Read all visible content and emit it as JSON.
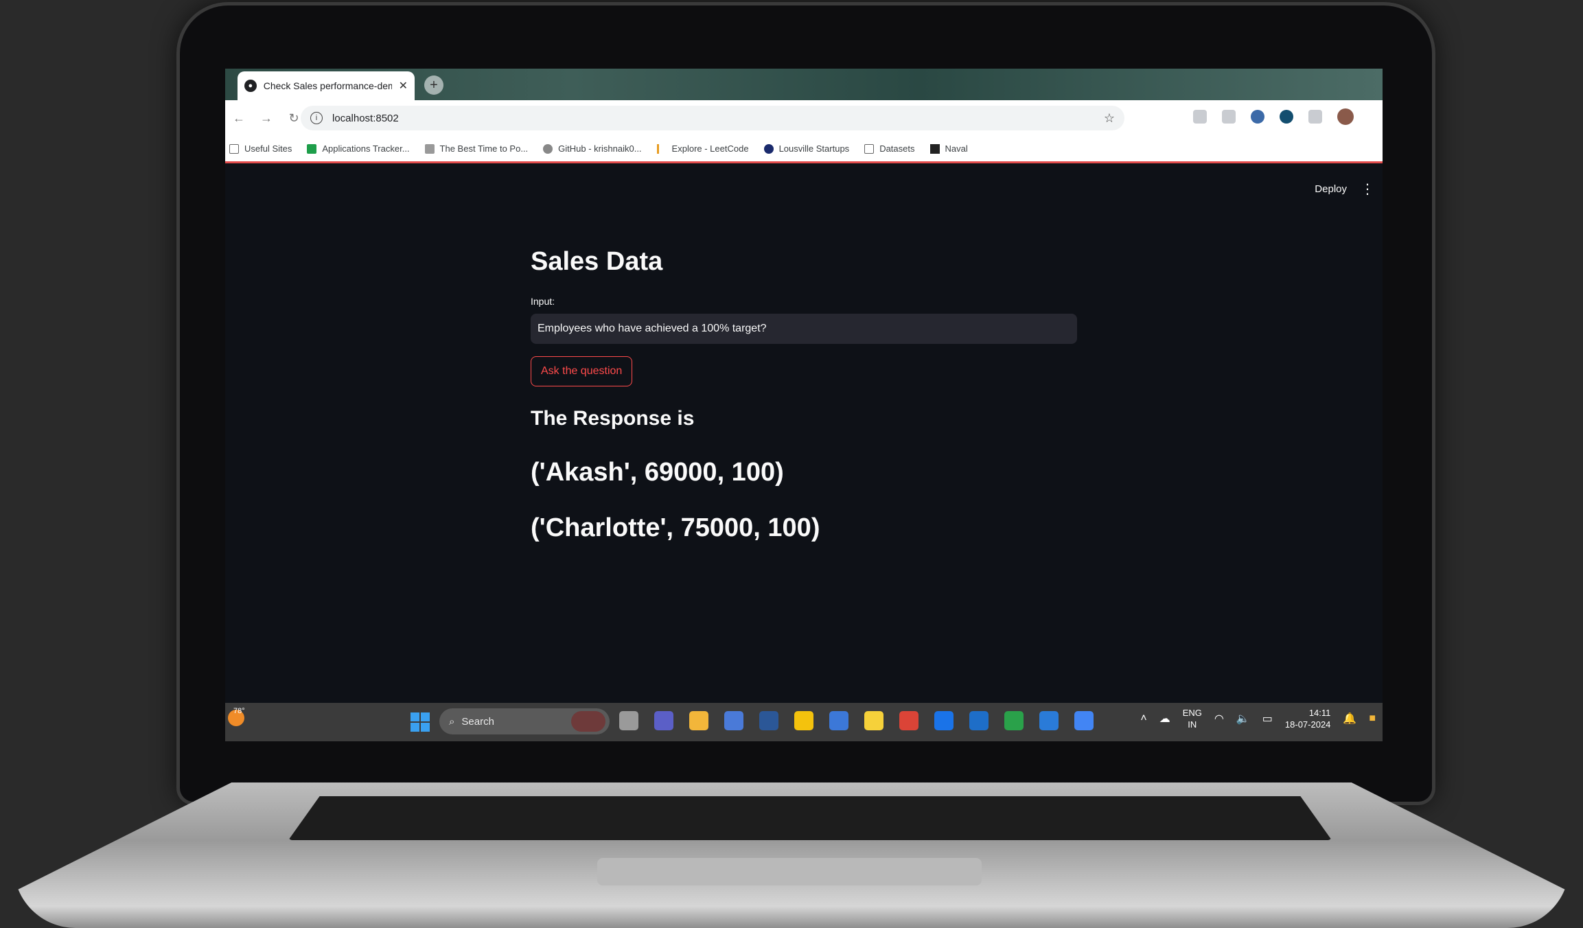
{
  "browser": {
    "tab_title": "Check Sales performance-demo",
    "tab_close": "✕",
    "new_tab": "+",
    "url": "localhost:8502",
    "bookmarks": [
      {
        "label": "Useful Sites",
        "icon": "folder-icon"
      },
      {
        "label": "Applications Tracker...",
        "icon": "sheets-icon"
      },
      {
        "label": "The Best Time to Po...",
        "icon": "buffer-icon"
      },
      {
        "label": "GitHub - krishnaik0...",
        "icon": "github-icon"
      },
      {
        "label": "Explore - LeetCode",
        "icon": "leetcode-icon"
      },
      {
        "label": "Lousville Startups",
        "icon": "startup-icon"
      },
      {
        "label": "Datasets",
        "icon": "folder-icon"
      },
      {
        "label": "Naval",
        "icon": "bookmark-icon"
      }
    ]
  },
  "app": {
    "deploy_label": "Deploy",
    "menu_glyph": "⋮",
    "title": "Sales Data",
    "input_label": "Input:",
    "input_value": "Employees who have achieved a 100% target?",
    "button_label": "Ask the question",
    "response_heading": "The Response is",
    "results": [
      "('Akash', 69000, 100)",
      "('Charlotte', 75000, 100)"
    ]
  },
  "taskbar": {
    "weather_temp": "78°",
    "search_placeholder": "Search",
    "lang_top": "ENG",
    "lang_bottom": "IN",
    "time": "14:11",
    "date": "18-07-2024",
    "app_colors": [
      "#9a9a9a",
      "#5b5fc7",
      "#f2b63a",
      "#4a7ad8",
      "#2b5797",
      "#f4c20d",
      "#3c78d8",
      "#f6d13a",
      "#db4437",
      "#1a73e8",
      "#1e6ec8",
      "#2aa14a",
      "#2a7bd8",
      "#4285f4"
    ]
  },
  "colors": {
    "app_background": "#0e1117",
    "accent": "#ff4b4b",
    "input_background": "#262730"
  }
}
